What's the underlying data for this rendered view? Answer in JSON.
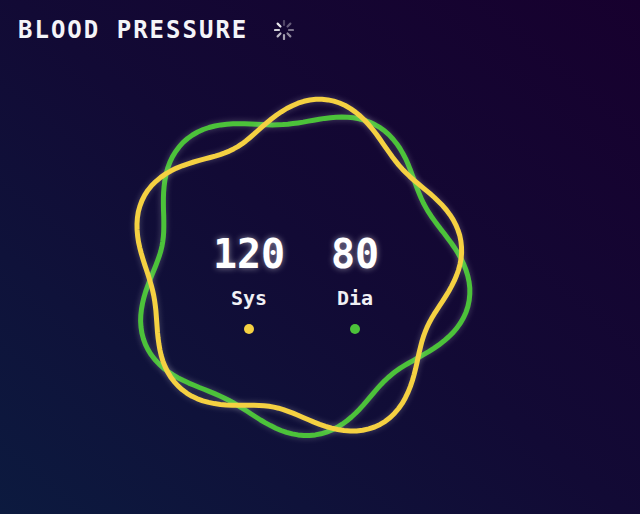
{
  "header": {
    "title": "BLOOD PRESSURE"
  },
  "readings": [
    {
      "value": "120",
      "label": "Sys",
      "color": "#f5d142"
    },
    {
      "value": "80",
      "label": "Dia",
      "color": "#4cc23a"
    }
  ]
}
